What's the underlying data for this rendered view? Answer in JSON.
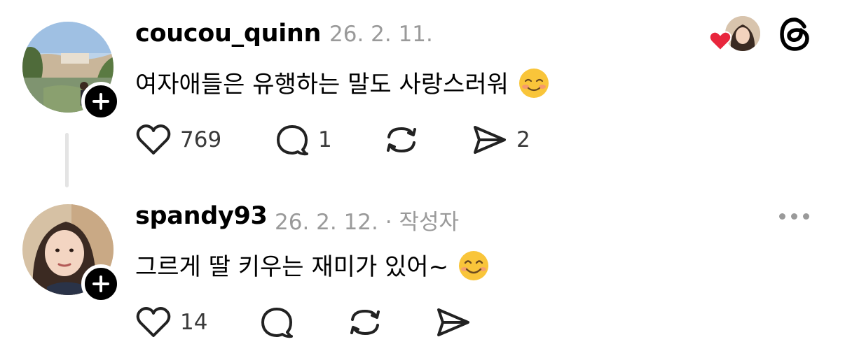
{
  "posts": [
    {
      "username": "coucou_quinn",
      "date": "26. 2. 11.",
      "text": "여자애들은 유행하는 말도 사랑스러워",
      "emoji": "smiling-blush",
      "likes": "769",
      "replies": "1",
      "shares": "2"
    },
    {
      "username": "spandy93",
      "date": "26. 2. 12.",
      "author_tag": "· 작성자",
      "text": "그르게 딸 키우는 재미가 있어~",
      "emoji": "smiling",
      "likes": "14"
    }
  ],
  "colors": {
    "accent_heart": "#e8263c",
    "muted_text": "#9a9a9a",
    "thread_line": "#e4e4e4",
    "follow_badge": "#000000"
  },
  "icons": [
    "heart-icon",
    "comment-icon",
    "repost-icon",
    "send-icon",
    "threads-logo-icon",
    "more-icon",
    "liked-heart-icon"
  ]
}
